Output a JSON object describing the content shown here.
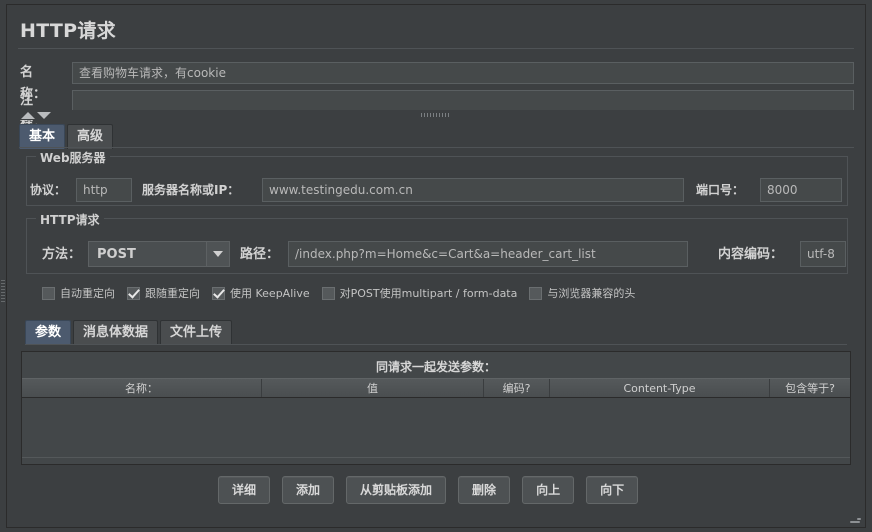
{
  "panel": {
    "title": "HTTP请求"
  },
  "name_field": {
    "label": "名称：",
    "value": "查看购物车请求，有cookie"
  },
  "comment_field": {
    "label": "注释：",
    "value": ""
  },
  "main_tabs": [
    {
      "label": "基本",
      "selected": true
    },
    {
      "label": "高级",
      "selected": false
    }
  ],
  "web_server": {
    "group_title": "Web服务器",
    "protocol_label": "协议：",
    "protocol_value": "http",
    "server_label": "服务器名称或IP：",
    "server_value": "www.testingedu.com.cn",
    "port_label": "端口号：",
    "port_value": "8000"
  },
  "http_request": {
    "group_title": "HTTP请求",
    "method_label": "方法：",
    "method_value": "POST",
    "path_label": "路径：",
    "path_value": "/index.php?m=Home&c=Cart&a=header_cart_list",
    "encoding_label": "内容编码：",
    "encoding_value": "utf-8"
  },
  "options": [
    {
      "label": "自动重定向",
      "checked": false
    },
    {
      "label": "跟随重定向",
      "checked": true
    },
    {
      "label": "使用 KeepAlive",
      "checked": true
    },
    {
      "label": "对POST使用multipart / form-data",
      "checked": false
    },
    {
      "label": "与浏览器兼容的头",
      "checked": false
    }
  ],
  "param_tabs": [
    {
      "label": "参数",
      "selected": true
    },
    {
      "label": "消息体数据",
      "selected": false
    },
    {
      "label": "文件上传",
      "selected": false
    }
  ],
  "param_table": {
    "caption": "同请求一起发送参数：",
    "columns": [
      "名称：",
      "值",
      "编码?",
      "Content-Type",
      "包含等于?"
    ],
    "rows": []
  },
  "buttons": [
    {
      "label": "详细"
    },
    {
      "label": "添加"
    },
    {
      "label": "从剪贴板添加"
    },
    {
      "label": "删除"
    },
    {
      "label": "向上"
    },
    {
      "label": "向下"
    }
  ],
  "colors": {
    "background": "#3c3f41",
    "field_bg": "#45494a",
    "tab_selected": "#4c5a6e",
    "text": "#bbbbbb"
  }
}
